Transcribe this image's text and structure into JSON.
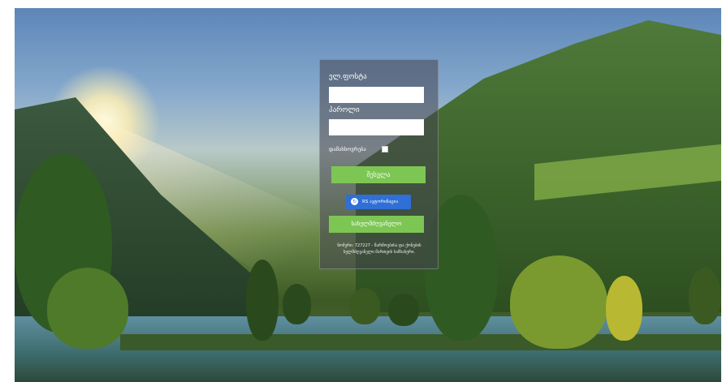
{
  "form": {
    "email_label": "ელ.ფოსტა",
    "email_value": "",
    "password_label": "პაროლი",
    "password_value": "",
    "remember_label": "დამახსოვრება",
    "login_button": "შესვლა",
    "rs_button": "RS ავტორიზაცია",
    "rs_icon_glyph": "↻",
    "register_button": "სახელმძღვანელო",
    "footer_note": "ნომერი: 727227 - წარმოებისა და ქონების ხელმძღვანელი მართვის სამსახური."
  },
  "colors": {
    "green_button": "#7dc654",
    "rs_blue": "#2f6fd6"
  },
  "icons": {
    "rs_icon": "refresh-icon"
  }
}
